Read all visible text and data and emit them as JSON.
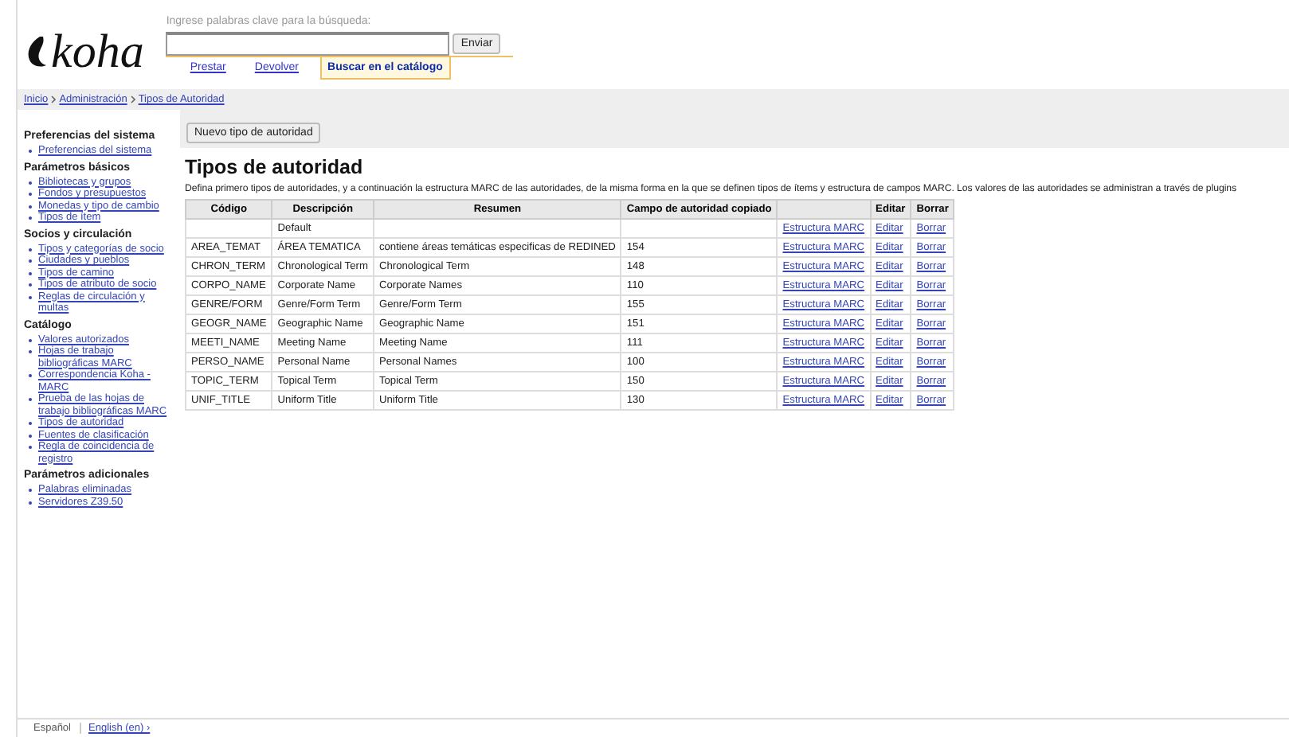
{
  "header": {
    "logo": "koha",
    "search_label": "Ingrese palabras clave para la búsqueda:",
    "search_button": "Enviar",
    "tabs": [
      {
        "label": "Prestar",
        "selected": false
      },
      {
        "label": "Devolver",
        "selected": false
      },
      {
        "label": "Buscar en el catálogo",
        "selected": true
      }
    ]
  },
  "breadcrumbs": [
    "Inicio",
    "Administración",
    "Tipos de Autoridad"
  ],
  "sidebar": [
    {
      "title": "Preferencias del sistema",
      "items": [
        "Preferencias del sistema"
      ]
    },
    {
      "title": "Parámetros básicos",
      "items": [
        "Bibliotecas y grupos",
        "Fondos y presupuestos",
        "Monedas y tipo de cambio",
        "Tipos de ítem"
      ]
    },
    {
      "title": "Socios y circulación",
      "items": [
        "Tipos y categorías de socio",
        "Ciudades y pueblos",
        "Tipos de camino",
        "Tipos de atributo de socio",
        "Reglas de circulación y multas"
      ]
    },
    {
      "title": "Catálogo",
      "items": [
        "Valores autorizados",
        "Hojas de trabajo bibliográficas MARC",
        "Correspondencia Koha - MARC",
        "Prueba de las hojas de trabajo bibliográficas MARC",
        "Tipos de autoridad",
        "Fuentes de clasificación",
        "Regla de coincidencia de registro"
      ]
    },
    {
      "title": "Parámetros adicionales",
      "items": [
        "Palabras eliminadas",
        "Servidores Z39.50"
      ]
    }
  ],
  "new_button": "Nuevo tipo de autoridad",
  "title": "Tipos de autoridad",
  "description": "Defina primero tipos de autoridades, y a continuación la estructura MARC de las autoridades, de la misma forma en la que se definen tipos de ítems y estructura de campos MARC. Los valores de las autoridades se administran a través de plugins",
  "table": {
    "columns": [
      "Código",
      "Descripción",
      "Resumen",
      "Campo de autoridad copiado",
      "",
      "Editar",
      "Borrar"
    ],
    "rows": [
      {
        "code": "",
        "description": "Default",
        "summary": "",
        "field": "",
        "structure": "Estructura MARC",
        "edit": "Editar",
        "delete": "Borrar"
      },
      {
        "code": "AREA_TEMAT",
        "description": "ÁREA TEMATICA",
        "summary": "contiene áreas temáticas especificas de REDINED",
        "field": "154",
        "structure": "Estructura MARC",
        "edit": "Editar",
        "delete": "Borrar"
      },
      {
        "code": "CHRON_TERM",
        "description": "Chronological Term",
        "summary": "Chronological Term",
        "field": "148",
        "structure": "Estructura MARC",
        "edit": "Editar",
        "delete": "Borrar"
      },
      {
        "code": "CORPO_NAME",
        "description": "Corporate Name",
        "summary": "Corporate Names",
        "field": "110",
        "structure": "Estructura MARC",
        "edit": "Editar",
        "delete": "Borrar"
      },
      {
        "code": "GENRE/FORM",
        "description": "Genre/Form Term",
        "summary": "Genre/Form Term",
        "field": "155",
        "structure": "Estructura MARC",
        "edit": "Editar",
        "delete": "Borrar"
      },
      {
        "code": "GEOGR_NAME",
        "description": "Geographic Name",
        "summary": "Geographic Name",
        "field": "151",
        "structure": "Estructura MARC",
        "edit": "Editar",
        "delete": "Borrar"
      },
      {
        "code": "MEETI_NAME",
        "description": "Meeting Name",
        "summary": "Meeting Name",
        "field": "111",
        "structure": "Estructura MARC",
        "edit": "Editar",
        "delete": "Borrar"
      },
      {
        "code": "PERSO_NAME",
        "description": "Personal Name",
        "summary": "Personal Names",
        "field": "100",
        "structure": "Estructura MARC",
        "edit": "Editar",
        "delete": "Borrar"
      },
      {
        "code": "TOPIC_TERM",
        "description": "Topical Term",
        "summary": "Topical Term",
        "field": "150",
        "structure": "Estructura MARC",
        "edit": "Editar",
        "delete": "Borrar"
      },
      {
        "code": "UNIF_TITLE",
        "description": "Uniform Title",
        "summary": "Uniform Title",
        "field": "130",
        "structure": "Estructura MARC",
        "edit": "Editar",
        "delete": "Borrar"
      }
    ]
  },
  "footer": {
    "languages": [
      {
        "label": "Español",
        "selected": true
      },
      {
        "label": "English (en) ›",
        "selected": false
      }
    ]
  }
}
